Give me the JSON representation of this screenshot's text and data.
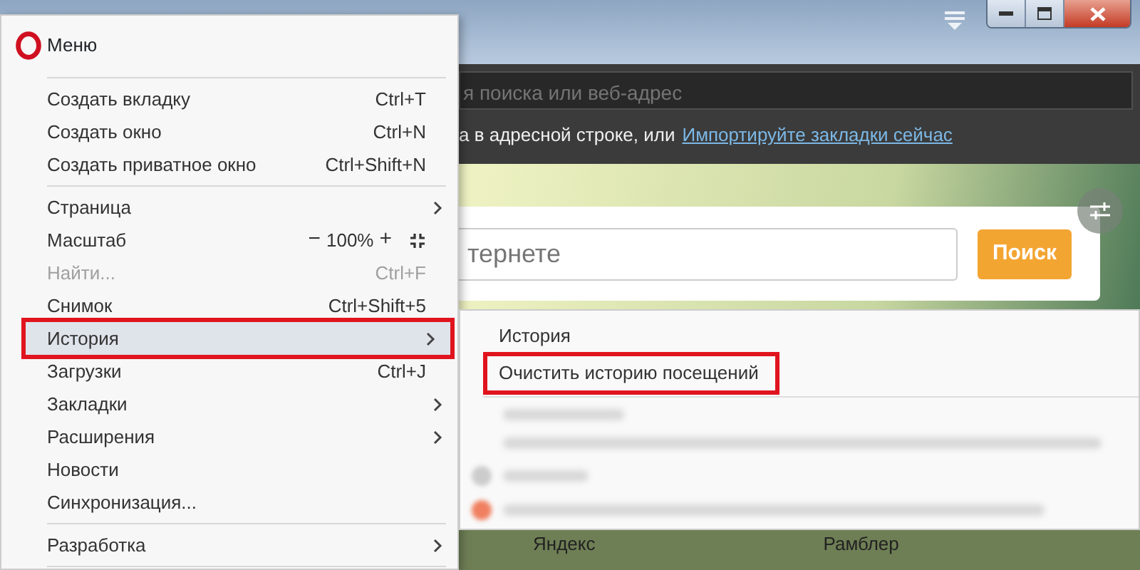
{
  "address_bar": {
    "placeholder": "я поиска или веб-адрес"
  },
  "bookmark_hint": {
    "text": "а в адресной строке, или",
    "link": "Импортируйте закладки сейчас"
  },
  "search": {
    "placeholder": "тернете",
    "button": "Поиск"
  },
  "menu": {
    "title": "Меню",
    "groups": [
      [
        {
          "label": "Создать вкладку",
          "kind": "shortcut",
          "shortcut": "Ctrl+T",
          "disabled": false,
          "selected": false,
          "highlighted": false
        },
        {
          "label": "Создать окно",
          "kind": "shortcut",
          "shortcut": "Ctrl+N",
          "disabled": false,
          "selected": false,
          "highlighted": false
        },
        {
          "label": "Создать приватное окно",
          "kind": "shortcut",
          "shortcut": "Ctrl+Shift+N",
          "disabled": false,
          "selected": false,
          "highlighted": false
        }
      ],
      [
        {
          "label": "Страница",
          "kind": "submenu",
          "disabled": false,
          "selected": false,
          "highlighted": false
        },
        {
          "label": "Масштаб",
          "kind": "zoom",
          "minus": "−",
          "value": "100%",
          "plus": "+",
          "disabled": false,
          "selected": false,
          "highlighted": false
        },
        {
          "label": "Найти...",
          "kind": "shortcut",
          "shortcut": "Ctrl+F",
          "disabled": true,
          "selected": false,
          "highlighted": false
        },
        {
          "label": "Снимок",
          "kind": "shortcut",
          "shortcut": "Ctrl+Shift+5",
          "disabled": false,
          "selected": false,
          "highlighted": false
        },
        {
          "label": "История",
          "kind": "submenu",
          "disabled": false,
          "selected": true,
          "highlighted": true
        },
        {
          "label": "Загрузки",
          "kind": "shortcut",
          "shortcut": "Ctrl+J",
          "disabled": false,
          "selected": false,
          "highlighted": false
        },
        {
          "label": "Закладки",
          "kind": "submenu",
          "disabled": false,
          "selected": false,
          "highlighted": false
        },
        {
          "label": "Расширения",
          "kind": "submenu",
          "disabled": false,
          "selected": false,
          "highlighted": false
        },
        {
          "label": "Новости",
          "kind": "plain",
          "disabled": false,
          "selected": false,
          "highlighted": false
        },
        {
          "label": "Синхронизация...",
          "kind": "plain",
          "disabled": false,
          "selected": false,
          "highlighted": false
        }
      ],
      [
        {
          "label": "Разработка",
          "kind": "submenu",
          "disabled": false,
          "selected": false,
          "highlighted": false
        }
      ]
    ]
  },
  "submenu": {
    "items": [
      {
        "label": "История",
        "highlighted": false
      },
      {
        "label": "Очистить историю посещений",
        "highlighted": true
      }
    ]
  },
  "speed_dial": [
    {
      "label": "Яндекс"
    },
    {
      "label": "Рамблер"
    }
  ]
}
